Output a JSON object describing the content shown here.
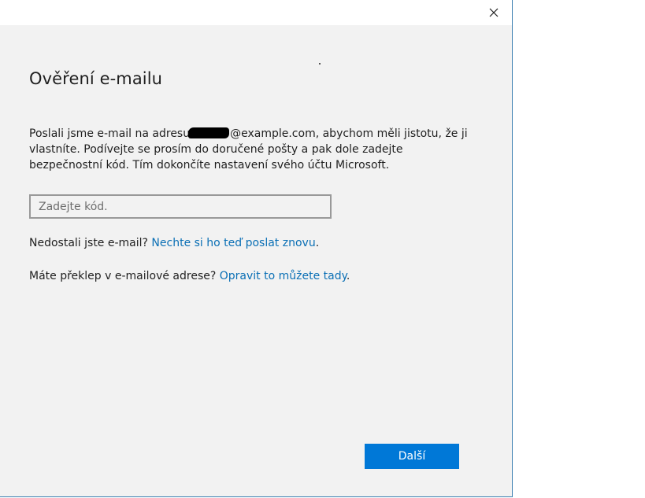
{
  "dialog": {
    "title": "Ověření e-mailu",
    "close_icon": "close-icon"
  },
  "message": {
    "before_email": "Poslali jsme e-mail na adresu",
    "email_suffix": "@example.com",
    "after_email": ", abychom měli jistotu, že ji vlastníte. Podívejte se prosím do doručené pošty a pak dole zadejte bezpečnostní kód. Tím dokončíte nastavení svého účtu Microsoft."
  },
  "code_input": {
    "placeholder": "Zadejte kód.",
    "value": ""
  },
  "resend": {
    "text": "Nedostali jste e-mail?",
    "link": "Nechte si ho teď poslat znovu",
    "end": "."
  },
  "typo": {
    "text": "Máte překlep v e-mailové adrese?",
    "link": "Opravit to můžete tady",
    "end": "."
  },
  "buttons": {
    "next_label": "Další"
  },
  "colors": {
    "accent": "#0078d7",
    "link": "#0a6fb5",
    "background": "#f2f2f2",
    "window_border": "#3c7fb1"
  }
}
